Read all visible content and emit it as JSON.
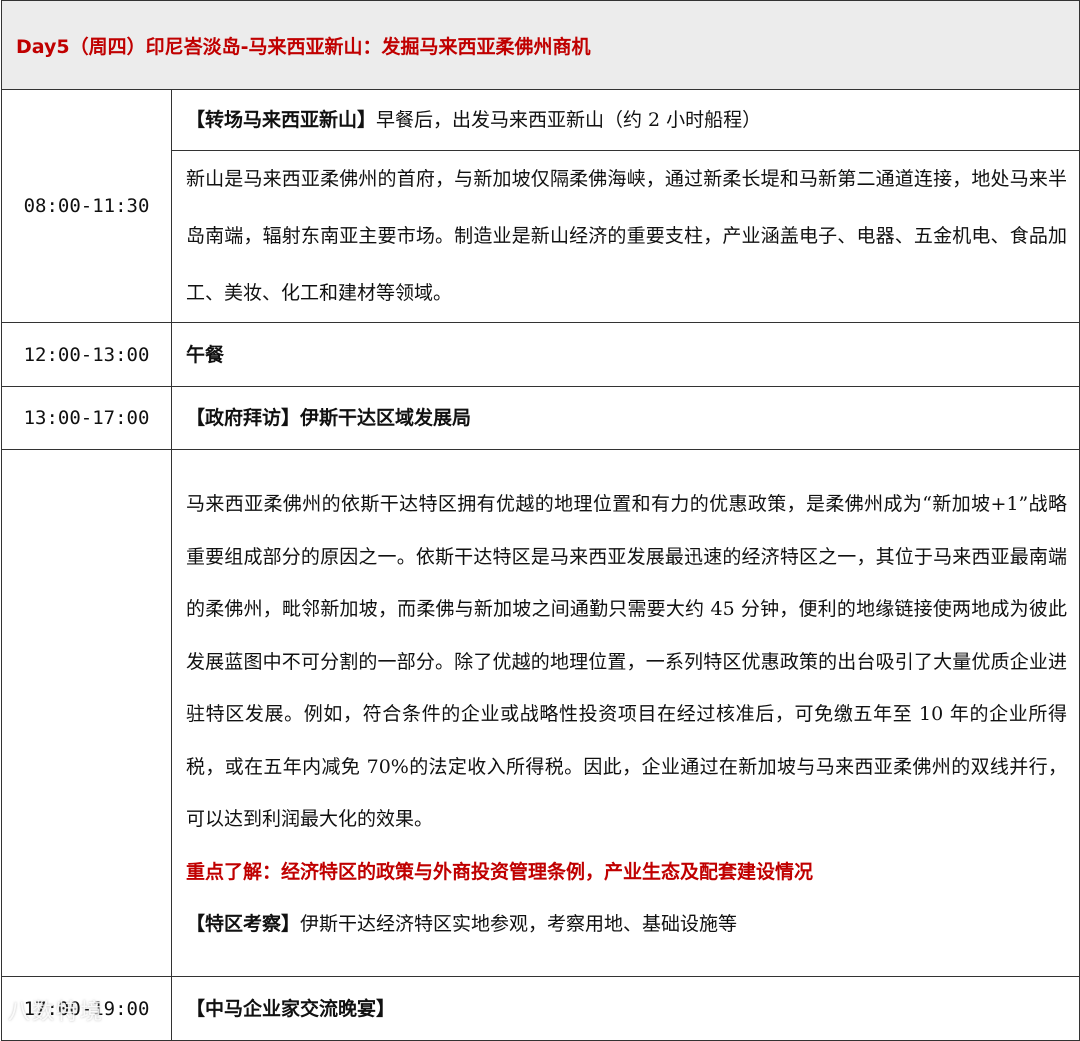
{
  "header": {
    "title": "Day5（周四）印尼峇淡岛-马来西亚新山：发掘马来西亚柔佛州商机"
  },
  "rows": {
    "r1": {
      "time": "08:00-11:30",
      "tag": "【转场马来西亚新山】",
      "text": "早餐后，出发马来西亚新山（约 2 小时船程）",
      "desc": "新山是马来西亚柔佛州的首府，与新加坡仅隔柔佛海峡，通过新柔长堤和马新第二通道连接，地处马来半岛南端，辐射东南亚主要市场。制造业是新山经济的重要支柱，产业涵盖电子、电器、五金机电、食品加工、美妆、化工和建材等领域。"
    },
    "r2": {
      "time": "12:00-13:00",
      "text": "午餐"
    },
    "r3": {
      "time": "13:00-17:00",
      "tag": "【政府拜访】",
      "text": "伊斯干达区域发展局",
      "desc": "马来西亚柔佛州的依斯干达特区拥有优越的地理位置和有力的优惠政策，是柔佛州成为“新加坡+1”战略重要组成部分的原因之一。依斯干达特区是马来西亚发展最迅速的经济特区之一，其位于马来西亚最南端的柔佛州，毗邻新加坡，而柔佛与新加坡之间通勤只需要大约 45 分钟，便利的地缘链接使两地成为彼此发展蓝图中不可分割的一部分。除了优越的地理位置，一系列特区优惠政策的出台吸引了大量优质企业进驻特区发展。例如，符合条件的企业或战略性投资项目在经过核准后，可免缴五年至 10 年的企业所得税，或在五年内减免 70%的法定收入所得税。因此，企业通过在新加坡与马来西亚柔佛州的双线并行，可以达到利润最大化的效果。",
      "highlight": "重点了解：经济特区的政策与外商投资管理条例，产业生态及配套建设情况",
      "visit_tag": "【特区考察】",
      "visit_text": "伊斯干达经济特区实地参观，考察用地、基础设施等"
    },
    "r4": {
      "time": "17:00-19:00",
      "text": "【中马企业家交流晚宴】"
    }
  },
  "watermark": {
    "text": "八数特境"
  }
}
